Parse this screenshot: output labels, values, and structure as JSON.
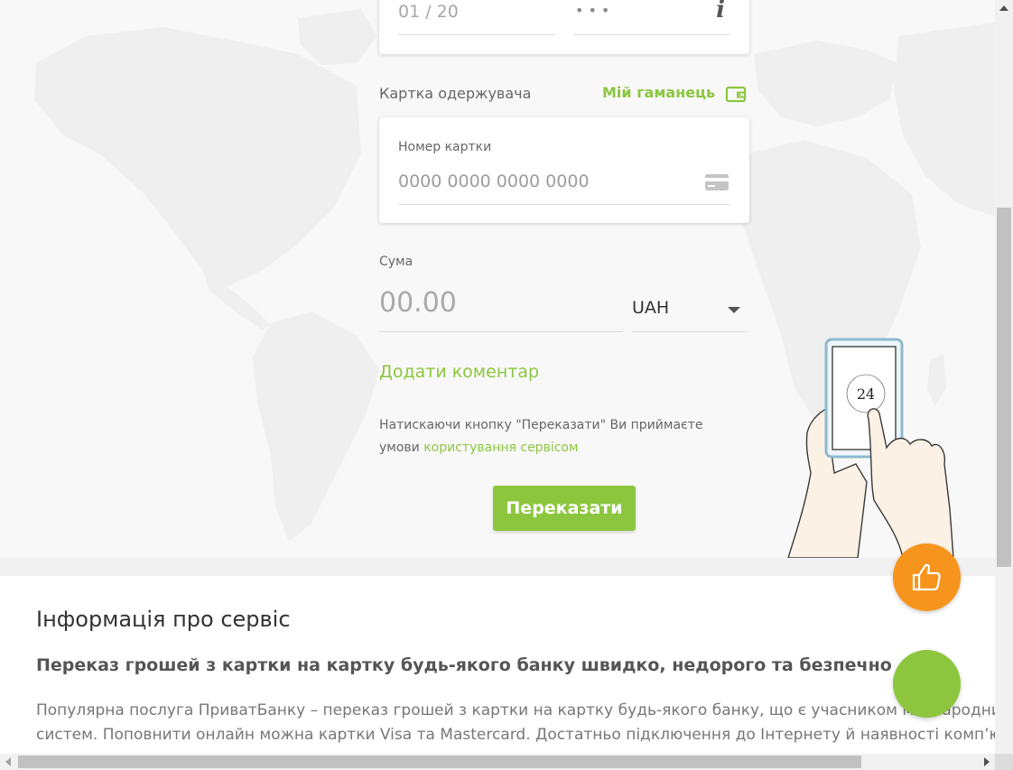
{
  "card_top": {
    "expiry_value": "01 / 20",
    "cvv_masked": "•••",
    "info_icon_glyph": "i"
  },
  "recipient": {
    "section_label": "Картка одержувача",
    "wallet_link": "Мій гаманець",
    "card_number_label": "Номер картки",
    "card_number_placeholder": "0000 0000 0000 0000"
  },
  "amount": {
    "label": "Сума",
    "placeholder": "00.00",
    "currency": "UAH"
  },
  "add_comment": "Додати коментар",
  "terms": {
    "text": "Натискаючи кнопку \"Переказати\" Ви приймаєте умови",
    "link": "користування сервісом"
  },
  "transfer_button": "Переказати",
  "illustration": {
    "phone_badge": "24"
  },
  "info": {
    "title": "Інформація про сервіс",
    "subtitle": "Переказ грошей з картки на картку будь-якого банку швидко, недорого та безпечно",
    "body_lines": [
      "Популярна послуга ПриватБанку – переказ грошей з картки на картку будь-якого банку, що є учасником міжнародних платіжних",
      "систем. Поповнити онлайн можна картки Visa та Mastercard. Достатньо підключення до Інтернету й наявності комп’ютера, планшета"
    ]
  },
  "colors": {
    "accent_green": "#8cc63f",
    "fab_orange": "#f7941d",
    "text_dark": "#333333",
    "text_muted": "#666666"
  },
  "icons": {
    "info": "info-icon",
    "wallet": "wallet-icon",
    "card": "credit-card-icon",
    "dropdown": "chevron-down-icon",
    "like": "thumbs-up-icon"
  }
}
